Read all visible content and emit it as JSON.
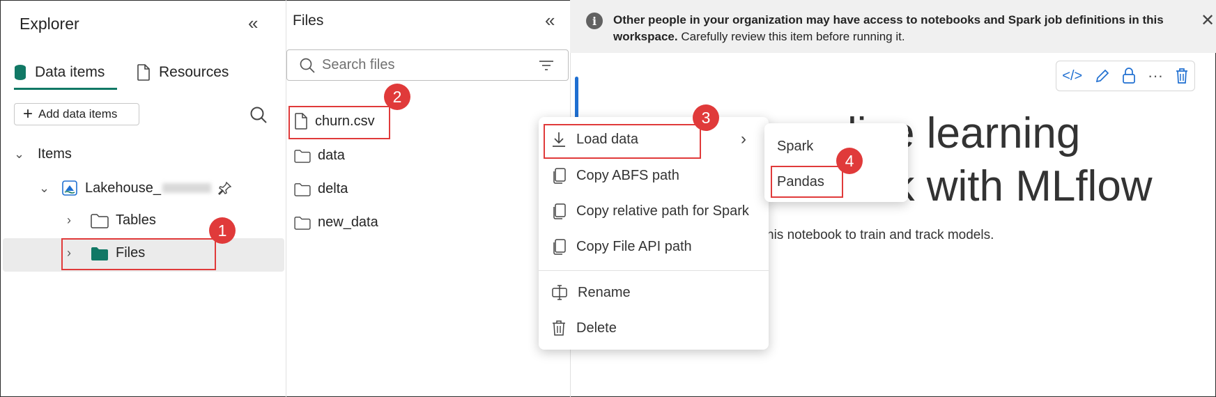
{
  "explorer": {
    "title": "Explorer",
    "tabs": [
      {
        "label": "Data items",
        "active": true
      },
      {
        "label": "Resources",
        "active": false
      }
    ],
    "add_button": "Add data items",
    "tree": {
      "section": "Items",
      "lakehouse": "Lakehouse_",
      "children": [
        "Tables",
        "Files"
      ]
    }
  },
  "files_pane": {
    "title": "Files",
    "search_placeholder": "Search files",
    "files": [
      "churn.csv",
      "data",
      "delta",
      "new_data"
    ]
  },
  "context_menu": {
    "items": [
      "Load data",
      "Copy ABFS path",
      "Copy relative path for Spark",
      "Copy File API path",
      "Rename",
      "Delete"
    ],
    "submenu": [
      "Spark",
      "Pandas"
    ]
  },
  "banner": {
    "bold": "Other people in your organization may have access to notebooks and Spark job definitions in this workspace.",
    "normal": " Carefully review this item before running it."
  },
  "notebook": {
    "heading_line1": "line learning",
    "heading_line2": "ack with MLflow",
    "description": "his notebook to train and track models."
  },
  "callouts": [
    "1",
    "2",
    "3",
    "4"
  ],
  "colors": {
    "accent": "#117865",
    "callout": "#e03a3a",
    "link": "#1f6fd1"
  }
}
